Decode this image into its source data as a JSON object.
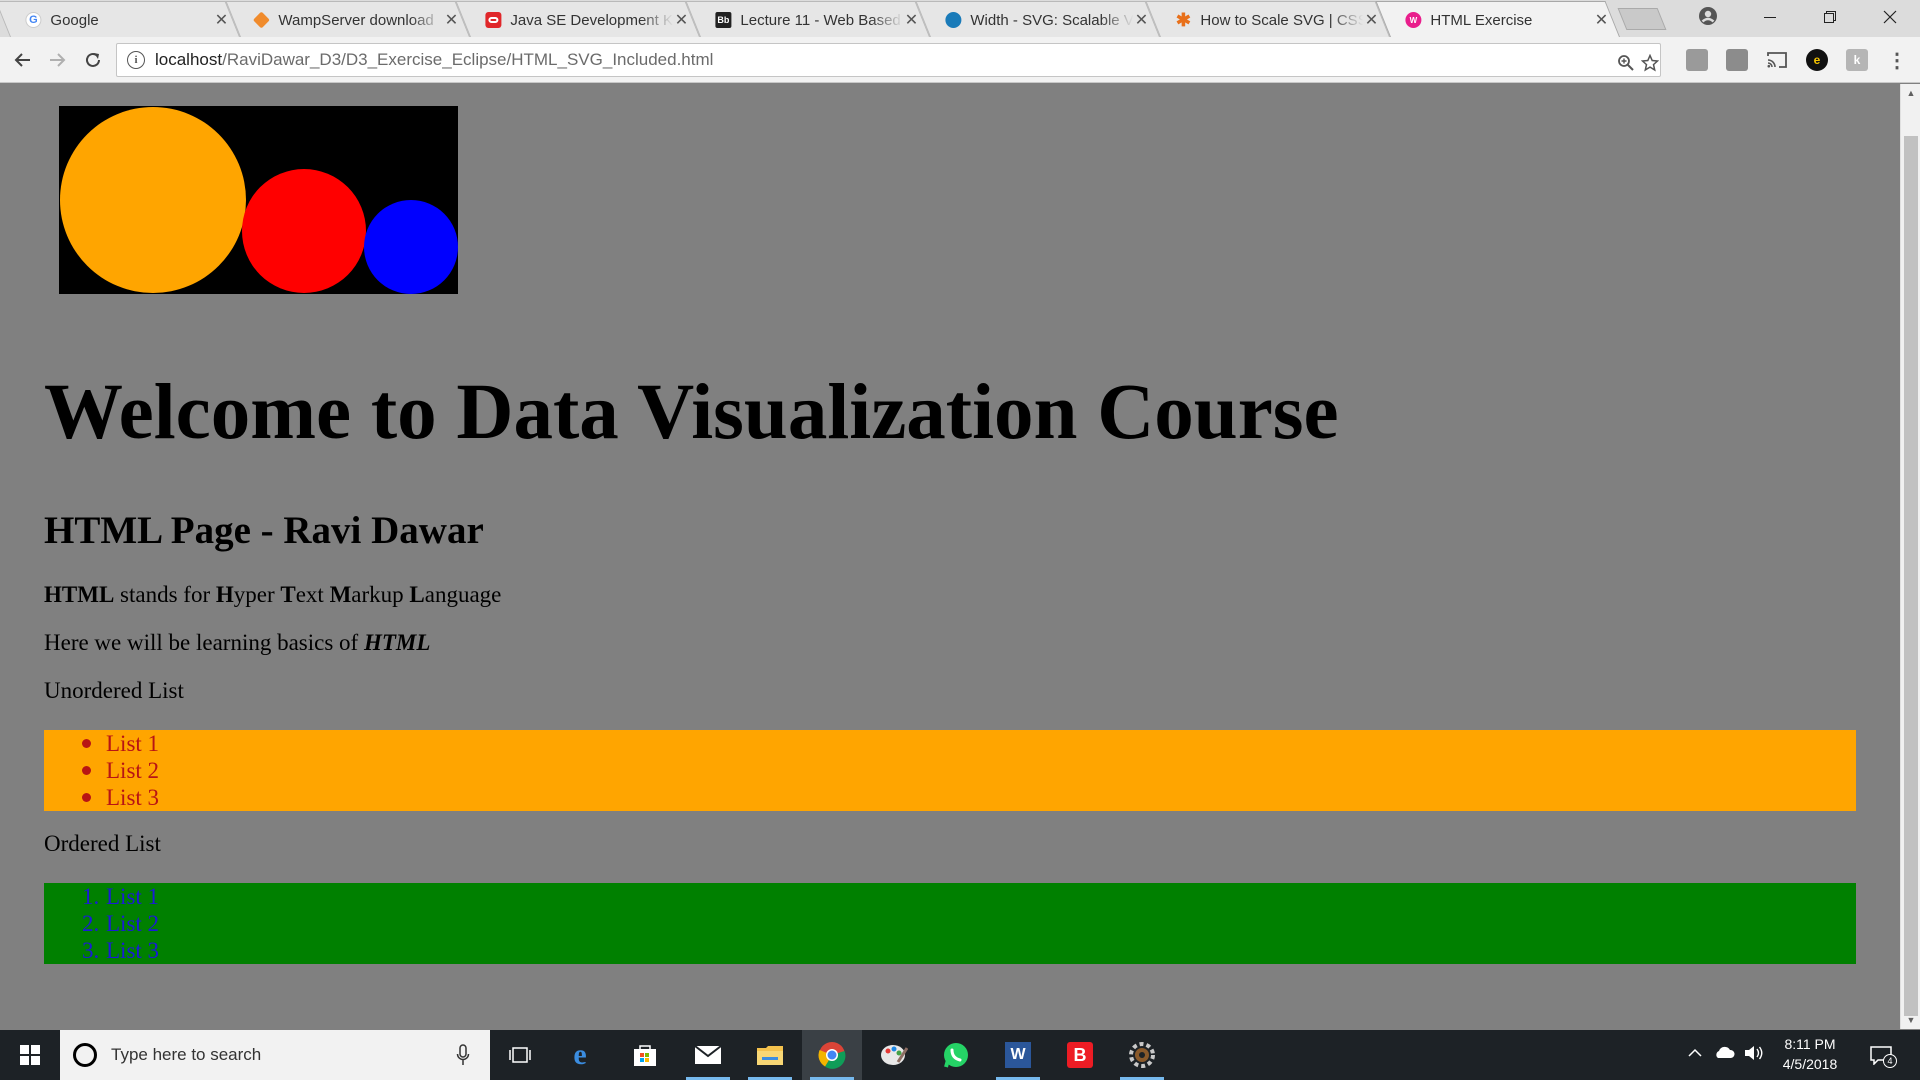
{
  "browser": {
    "tabs": [
      {
        "title": "Google",
        "favicon": "google-icon",
        "color": "#4285f4"
      },
      {
        "title": "WampServer download",
        "favicon": "wampserver-icon",
        "color": "#f08b2c"
      },
      {
        "title": "Java SE Development Kit",
        "favicon": "oracle-icon",
        "color": "#e0272a"
      },
      {
        "title": "Lecture 11 - Web Based",
        "favicon": "blackboard-icon",
        "color": "#222222"
      },
      {
        "title": "Width - SVG: Scalable Vector",
        "favicon": "mdn-icon",
        "color": "#1a7bb9"
      },
      {
        "title": "How to Scale SVG | CSS",
        "favicon": "csstricks-icon",
        "color": "#e8701a"
      },
      {
        "title": "HTML Exercise",
        "favicon": "html-exercise-icon",
        "color": "#e91e8c",
        "active": true
      }
    ],
    "close_glyph": "✕",
    "url": {
      "host": "localhost",
      "path": "/RaviDawar_D3/D3_Exercise_Eclipse/HTML_SVG_Included.html"
    },
    "info_glyph": "i"
  },
  "page": {
    "svg": {
      "background": "#000000",
      "circles": [
        {
          "name": "orange-circle",
          "color": "#ffa500"
        },
        {
          "name": "red-circle",
          "color": "#ff0000"
        },
        {
          "name": "blue-circle",
          "color": "#0000ff"
        }
      ]
    },
    "main_title": "Welcome to Data Visualization Course",
    "sub_title": "HTML Page - Ravi Dawar",
    "para1": {
      "html_bold": "HTML",
      "stands_for": " stands for ",
      "h": "H",
      "yper": "yper ",
      "t": "T",
      "ext": "ext ",
      "m": "M",
      "arkup": "arkup ",
      "l": "L",
      "anguage": "anguage"
    },
    "para2": {
      "text": "Here we will be learning basics of ",
      "emph": "HTML"
    },
    "unordered_label": "Unordered List",
    "unordered_items": [
      "List 1",
      "List 2",
      "List 3"
    ],
    "ordered_label": "Ordered List",
    "ordered_items": [
      "List 1",
      "List 2",
      "List 3"
    ],
    "ordered_numbers": [
      "1.",
      "2.",
      "3."
    ],
    "colors": {
      "page_bg": "#808080",
      "ul_bg": "#ffa500",
      "ul_text": "#b81414",
      "ol_bg": "#008000",
      "ol_text": "#1a1ad6"
    }
  },
  "taskbar": {
    "search_placeholder": "Type here to search",
    "apps": [
      "task-view-icon",
      "edge-icon",
      "store-icon",
      "mail-icon",
      "file-explorer-icon",
      "chrome-icon",
      "paint-icon",
      "whatsapp-icon",
      "word-icon",
      "bitdefender-icon",
      "settings-gear-icon"
    ],
    "word_glyph": "W",
    "bitdefender_glyph": "B",
    "time": "8:11 PM",
    "date": "4/5/2018",
    "notification_count": "4"
  }
}
